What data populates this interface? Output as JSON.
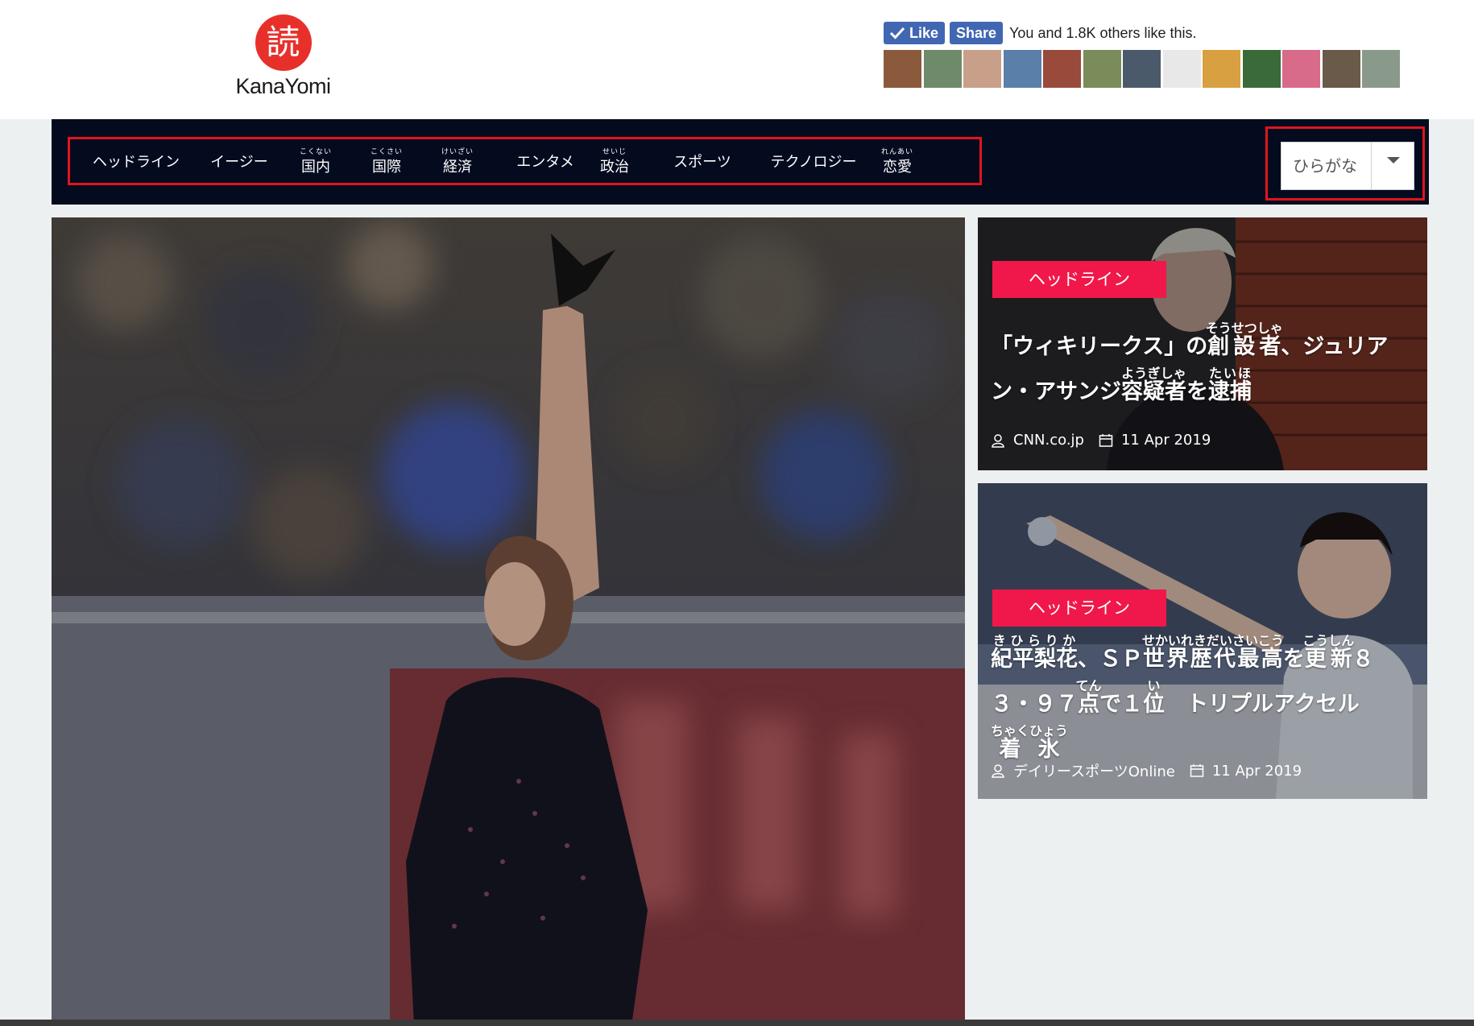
{
  "brand": {
    "logo_char": "読",
    "name": "KanaYomi"
  },
  "facebook": {
    "like_label": "Like",
    "share_label": "Share",
    "social_text": "You and 1.8K others like this.",
    "face_colors": [
      "#8b5a3c",
      "#6f8a6a",
      "#c89f88",
      "#5a7fa8",
      "#9a4a3a",
      "#7a8c5a",
      "#4a5a6a",
      "#e8e8e8",
      "#d8a040",
      "#3a6a3a",
      "#d86a8a",
      "#6a5a4a",
      "#8a9a8a"
    ]
  },
  "nav": {
    "items": [
      {
        "label": "ヘッドライン",
        "reading": ""
      },
      {
        "label": "イージー",
        "reading": ""
      },
      {
        "label": "国内",
        "reading": "こくない"
      },
      {
        "label": "国際",
        "reading": "こくさい"
      },
      {
        "label": "経済",
        "reading": "けいざい"
      },
      {
        "label": "エンタメ",
        "reading": ""
      },
      {
        "label": "政治",
        "reading": "せいじ"
      },
      {
        "label": "スポーツ",
        "reading": ""
      },
      {
        "label": "テクノロジー",
        "reading": ""
      },
      {
        "label": "恋愛",
        "reading": "れんあい"
      }
    ],
    "language": {
      "selected": "ひらがな"
    }
  },
  "articles": [
    {
      "badge": "ヘッドライン",
      "title_plain": "「ウィキリークス」の創設者、ジュリアン・アサンジ容疑者を逮捕",
      "segments": [
        {
          "t": "「ウィキリークス」の"
        },
        {
          "t": "創設者",
          "r": "そうせつしゃ"
        },
        {
          "t": "、ジュリア"
        },
        {
          "br": true
        },
        {
          "t": "ン・アサンジ"
        },
        {
          "t": "容疑者",
          "r": "ようぎしゃ"
        },
        {
          "t": "を"
        },
        {
          "t": "逮捕",
          "r": "たいほ"
        }
      ],
      "source": "CNN.co.jp",
      "date": "11 Apr 2019"
    },
    {
      "badge": "ヘッドライン",
      "title_plain": "紀平梨花、SP世界歴代最高を更新83・97点で1位 トリプルアクセル着氷",
      "segments": [
        {
          "t": "紀平梨花",
          "r": "きひらりか"
        },
        {
          "t": "、ＳＰ"
        },
        {
          "t": "世界歴代最高",
          "r": "せかいれきだいさいこう"
        },
        {
          "t": "を"
        },
        {
          "t": "更新",
          "r": "こうしん"
        },
        {
          "t": "８"
        },
        {
          "br": true
        },
        {
          "t": "３・９７"
        },
        {
          "t": "点",
          "r": "てん"
        },
        {
          "t": "で１"
        },
        {
          "t": "位",
          "r": "い"
        },
        {
          "t": "　トリプルアクセル"
        },
        {
          "t": "着氷",
          "r": "ちゃくひょう"
        }
      ],
      "source": "デイリースポーツOnline",
      "date": "11 Apr 2019"
    }
  ]
}
